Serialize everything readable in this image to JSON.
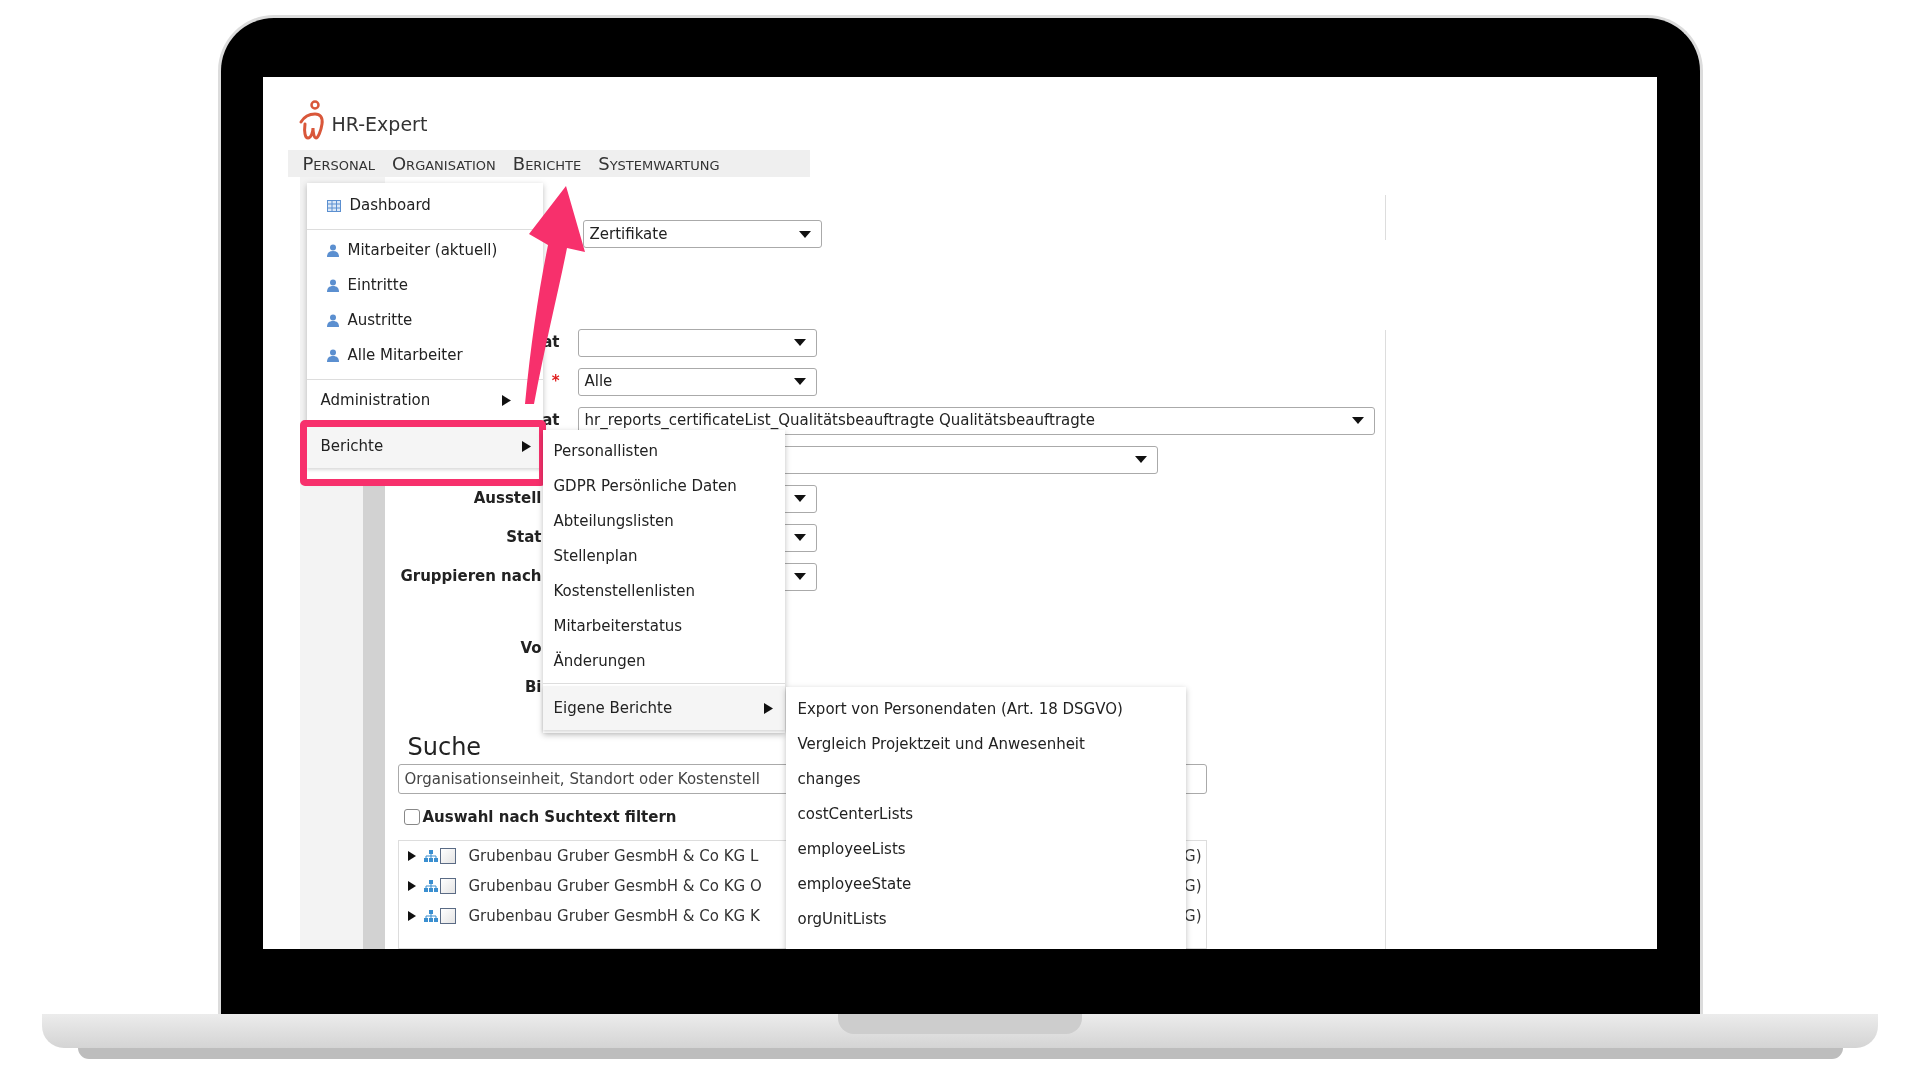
{
  "app": {
    "name": "HR-Expert"
  },
  "menu_bar": [
    {
      "label": "Personal"
    },
    {
      "label": "Organisation"
    },
    {
      "label": "Berichte"
    },
    {
      "label": "Systemwartung"
    }
  ],
  "form": {
    "top_select": {
      "value": "Zertifikate"
    },
    "rows": [
      {
        "label": "at",
        "select": {
          "kind": "short"
        }
      },
      {
        "required_mark": "*",
        "select": {
          "kind": "short",
          "value": "Alle"
        }
      },
      {
        "label": "at",
        "select": {
          "kind": "wide",
          "value": "hr_reports_certificateList_Qualitätsbeauftragte Qualitätsbeauftragte"
        }
      },
      {
        "select": {
          "kind": "medium"
        }
      },
      {
        "label": "Ausstell",
        "select": {
          "kind": "short"
        }
      },
      {
        "label": "Stat",
        "select": {
          "kind": "short"
        }
      },
      {
        "label": "Gruppieren nach",
        "select": {
          "kind": "short"
        }
      },
      {
        "label": "Vo"
      },
      {
        "label": "Bi"
      }
    ]
  },
  "search": {
    "title": "Suche",
    "placeholder": "Organisationseinheit, Standort oder Kostenstell",
    "filter": {
      "label": "Auswahl nach Suchtext filtern",
      "checked": false
    }
  },
  "tree": [
    {
      "label": "Grubenbau Gruber GesmbH & Co KG L",
      "tail": "G)",
      "expanded": false,
      "checked": false
    },
    {
      "label": "Grubenbau Gruber GesmbH & Co KG O",
      "tail": "G)",
      "expanded": false,
      "checked": false
    },
    {
      "label": "Grubenbau Gruber GesmbH & Co KG K",
      "tail": "G)",
      "expanded": false,
      "checked": false
    }
  ],
  "personal_menu": {
    "groups": [
      [
        {
          "kind": "grid",
          "label": "Dashboard",
          "selected": false
        }
      ],
      [
        {
          "kind": "person",
          "label": "Mitarbeiter (aktuell)",
          "selected": false
        },
        {
          "kind": "person",
          "label": "Eintritte",
          "selected": false
        },
        {
          "kind": "person",
          "label": "Austritte",
          "selected": false
        },
        {
          "kind": "person",
          "label": "Alle Mitarbeiter",
          "selected": false
        }
      ],
      [
        {
          "kind": "submenu",
          "label": "Administration",
          "selected": false
        },
        {
          "kind": "submenu",
          "label": "Berichte",
          "selected": true
        }
      ]
    ]
  },
  "reports_menu": {
    "groups": [
      [
        {
          "kind": "plain",
          "label": "Personallisten",
          "selected": false
        },
        {
          "kind": "plain",
          "label": "GDPR Persönliche Daten",
          "selected": false
        },
        {
          "kind": "plain",
          "label": "Abteilungslisten",
          "selected": false
        },
        {
          "kind": "plain",
          "label": "Stellenplan",
          "selected": false
        },
        {
          "kind": "plain",
          "label": "Kostenstellenlisten",
          "selected": false
        },
        {
          "kind": "plain",
          "label": "Mitarbeiterstatus",
          "selected": false
        },
        {
          "kind": "plain",
          "label": "Änderungen",
          "selected": false
        }
      ],
      [
        {
          "kind": "submenu",
          "label": "Eigene Berichte",
          "selected": true
        }
      ]
    ]
  },
  "custom_reports_menu": {
    "items": [
      {
        "label": "Export von Personendaten (Art. 18 DSGVO)"
      },
      {
        "label": "Vergleich Projektzeit und Anwesenheit"
      },
      {
        "label": "changes"
      },
      {
        "label": "costCenterLists"
      },
      {
        "label": "employeeLists"
      },
      {
        "label": "employeeState"
      },
      {
        "label": "orgUnitLists"
      }
    ]
  }
}
